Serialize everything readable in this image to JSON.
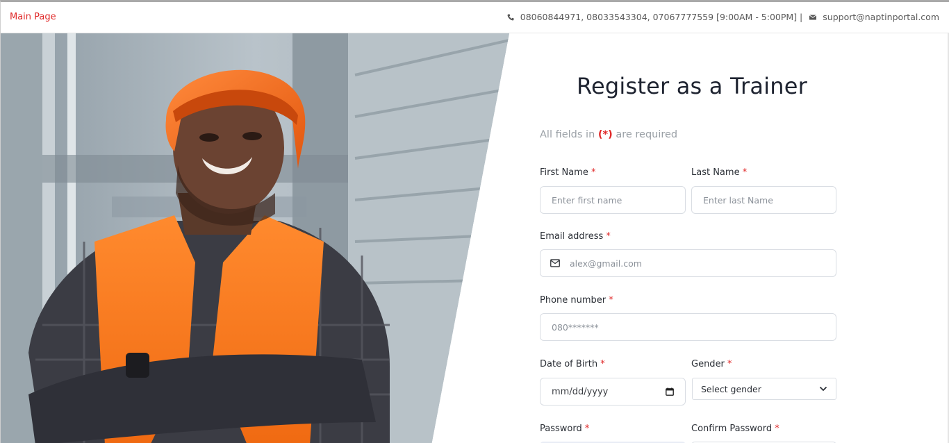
{
  "topbar": {
    "main_link": "Main Page",
    "phones": "08060844971, 08033543304, 07067777559 [9:00AM - 5:00PM] |",
    "email": "support@naptinportal.com",
    "phone_icon": "phone-icon",
    "email_icon": "envelope-icon"
  },
  "form": {
    "title": "Register as a Trainer",
    "required_note_prefix": "All fields in ",
    "required_note_star": "(*)",
    "required_note_suffix": " are required",
    "first_name": {
      "label": "First Name",
      "placeholder": "Enter first name"
    },
    "last_name": {
      "label": "Last Name",
      "placeholder": "Enter last Name"
    },
    "email": {
      "label": "Email address",
      "placeholder": "alex@gmail.com"
    },
    "phone": {
      "label": "Phone number",
      "placeholder": "080*******"
    },
    "dob": {
      "label": "Date of Birth",
      "value": "mm/dd/yyyy"
    },
    "gender": {
      "label": "Gender",
      "value": "Select gender"
    },
    "password": {
      "label": "Password"
    },
    "confirm_password": {
      "label": "Confirm Password"
    },
    "asterisk": "*"
  },
  "colors": {
    "accent_red": "#e02828",
    "title": "#1e2330",
    "vest_orange": "#ff7a1f",
    "helmet_orange": "#f26a1b"
  }
}
